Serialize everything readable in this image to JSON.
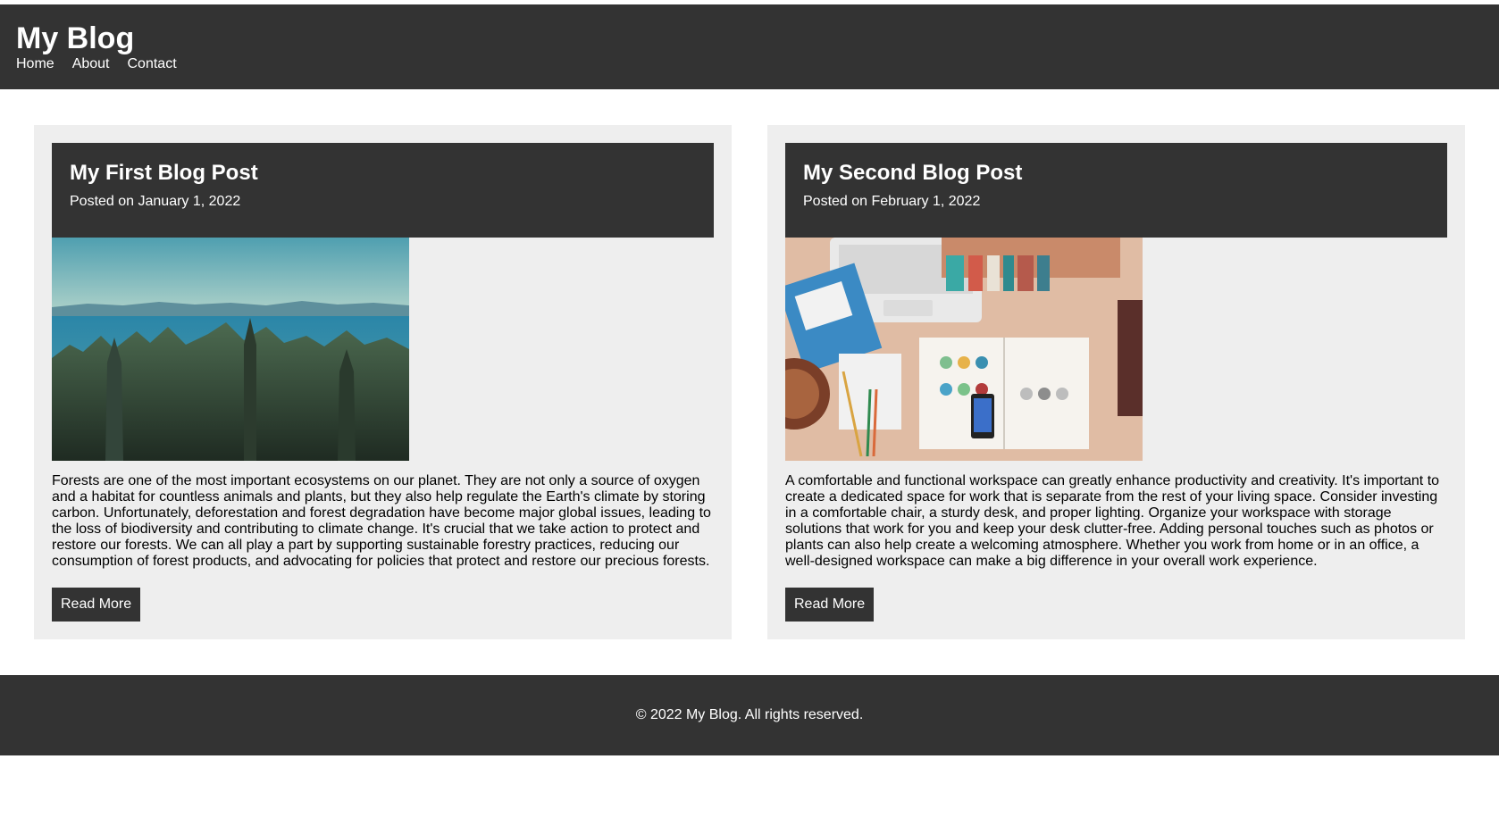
{
  "header": {
    "title": "My Blog",
    "nav": [
      "Home",
      "About",
      "Contact"
    ]
  },
  "posts": [
    {
      "title": "My First Blog Post",
      "date": "Posted on January 1, 2022",
      "image_icon": "forest-lake-photo",
      "body": "Forests are one of the most important ecosystems on our planet. They are not only a source of oxygen and a habitat for countless animals and plants, but they also help regulate the Earth's climate by storing carbon. Unfortunately, deforestation and forest degradation have become major global issues, leading to the loss of biodiversity and contributing to climate change. It's crucial that we take action to protect and restore our forests. We can all play a part by supporting sustainable forestry practices, reducing our consumption of forest products, and advocating for policies that protect and restore our precious forests.",
      "button": "Read More"
    },
    {
      "title": "My Second Blog Post",
      "date": "Posted on February 1, 2022",
      "image_icon": "desk-workspace-photo",
      "body": "A comfortable and functional workspace can greatly enhance productivity and creativity. It's important to create a dedicated space for work that is separate from the rest of your living space. Consider investing in a comfortable chair, a sturdy desk, and proper lighting. Organize your workspace with storage solutions that work for you and keep your desk clutter-free. Adding personal touches such as photos or plants can also help create a welcoming atmosphere. Whether you work from home or in an office, a well-designed workspace can make a big difference in your overall work experience.",
      "button": "Read More"
    }
  ],
  "footer": {
    "text": "© 2022 My Blog. All rights reserved."
  },
  "colors": {
    "dark": "#333333",
    "card": "#eeeeee"
  }
}
